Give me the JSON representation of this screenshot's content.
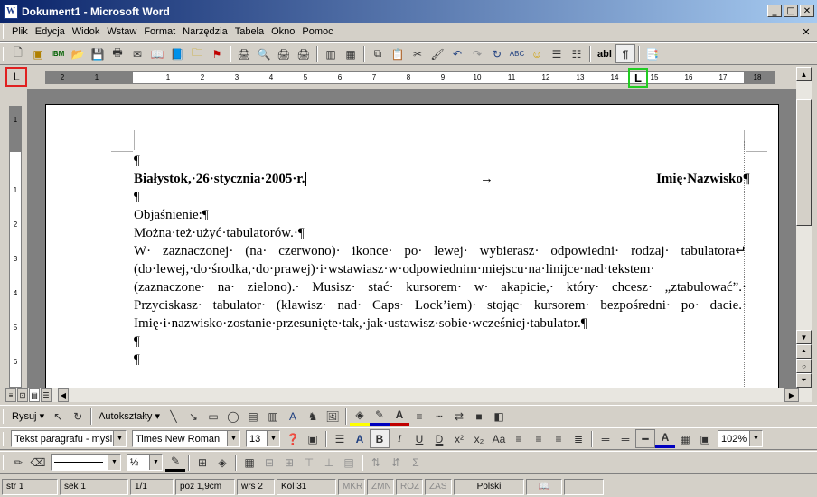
{
  "window": {
    "title": "Dokument1 - Microsoft Word",
    "app_icon": "W",
    "minimize": "_",
    "maximize": "□",
    "close": "✕"
  },
  "menu": [
    "Plik",
    "Edycja",
    "Widok",
    "Wstaw",
    "Format",
    "Narzędzia",
    "Tabela",
    "Okno",
    "Pomoc"
  ],
  "doc_close": "✕",
  "standard_toolbar": {
    "style_text": "abl",
    "pilcrow": "¶"
  },
  "drawing_toolbar": {
    "draw_label": "Rysuj",
    "autoshapes_label": "Autokształty"
  },
  "formatting_toolbar": {
    "style_value": "Tekst paragrafu - myślr",
    "font_value": "Times New Roman",
    "size_value": "13",
    "zoom_value": "102%"
  },
  "ruler": {
    "tab_selector": "L",
    "tab_marker": "L",
    "numbers_left": [
      "2",
      "1"
    ],
    "numbers_right": [
      "1",
      "2",
      "3",
      "4",
      "5",
      "6",
      "7",
      "8",
      "9",
      "10",
      "11",
      "12",
      "13",
      "14",
      "15",
      "16",
      "17",
      "18"
    ],
    "vertical_numbers": [
      "1",
      "1",
      "2",
      "3",
      "4",
      "5",
      "6"
    ]
  },
  "document": {
    "p0": "¶",
    "line1_left": "Białystok,·26·stycznia·2005·r.",
    "line1_arrow": "→",
    "line1_right": "Imię·Nazwisko¶",
    "p2": "¶",
    "p3": "Objaśnienie:¶",
    "p4": "Można·też·użyć·tabulatorów.·¶",
    "p5": "W· zaznaczonej· (na· czerwono)· ikonce· po· lewej· wybierasz· odpowiedni· rodzaj· tabulatora↵",
    "p6": "(do·lewej,·do·środka,·do·prawej)·i·wstawiasz·w·odpowiednim·miejscu·na·linijce·nad·tekstem·",
    "p7": "(zaznaczone· na· zielono).· Musisz· stać· kursorem· w· akapicie,· który· chcesz· „ztabulować”.·",
    "p8": "Przyciskasz· tabulator· (klawisz· nad· Caps· Lock’iem)· stojąc· kursorem· bezpośredni· po· dacie.·",
    "p9": "Imię·i·nazwisko·zostanie·przesunięte·tak,·jak·ustawisz·sobie·wcześniej·tabulator.¶",
    "p10": "¶",
    "p11": "¶"
  },
  "status": {
    "page": "str 1",
    "section": "sek 1",
    "pages": "1/1",
    "pos": "poz 1,9cm",
    "line": "wrs 2",
    "col": "Kol 31",
    "rec": "MKR",
    "trk": "ZMN",
    "ext": "ROZ",
    "ovr": "ZAS",
    "lang": "Polski"
  }
}
